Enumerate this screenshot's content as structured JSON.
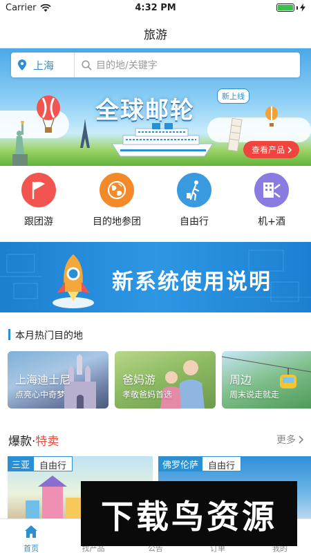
{
  "status_bar": {
    "carrier": "Carrier",
    "time": "4:32 PM"
  },
  "nav": {
    "title": "旅游"
  },
  "search": {
    "city": "上海",
    "placeholder": "目的地/关键字"
  },
  "hero": {
    "title": "全球邮轮",
    "badge": "新上线",
    "cta": "查看产品"
  },
  "categories": [
    {
      "label": "跟团游",
      "icon": "flag-icon",
      "color": "#f2544f"
    },
    {
      "label": "目的地参团",
      "icon": "globe-icon",
      "color": "#f38a2a"
    },
    {
      "label": "自由行",
      "icon": "walker-icon",
      "color": "#3a9ae0"
    },
    {
      "label": "机+酒",
      "icon": "hotel-icon",
      "color": "#8a7be0"
    }
  ],
  "system_banner": {
    "title": "新系统使用说明"
  },
  "hot_destinations": {
    "title": "本月热门目的地",
    "items": [
      {
        "name": "上海迪士尼",
        "subtitle": "点亮心中奇梦"
      },
      {
        "name": "爸妈游",
        "subtitle": "孝敬爸妈首选"
      },
      {
        "name": "周边",
        "subtitle": "周末说走就走"
      }
    ]
  },
  "hot_sale": {
    "title_prefix": "爆款·",
    "title_highlight": "特卖",
    "more": "更多",
    "products": [
      {
        "location": "三亚",
        "type": "自由行"
      },
      {
        "location": "佛罗伦萨",
        "type": "自由行"
      }
    ]
  },
  "watermark": "下载鸟资源",
  "tabs": [
    {
      "label": "首页",
      "icon": "home-icon",
      "active": true
    },
    {
      "label": "找产品",
      "icon": "search-icon",
      "active": false
    },
    {
      "label": "公告",
      "icon": "bell-icon",
      "active": false
    },
    {
      "label": "订单",
      "icon": "order-icon",
      "active": false
    },
    {
      "label": "我的",
      "icon": "user-icon",
      "active": false
    }
  ],
  "colors": {
    "accent": "#2b8fd4",
    "highlight": "#f0443e"
  }
}
